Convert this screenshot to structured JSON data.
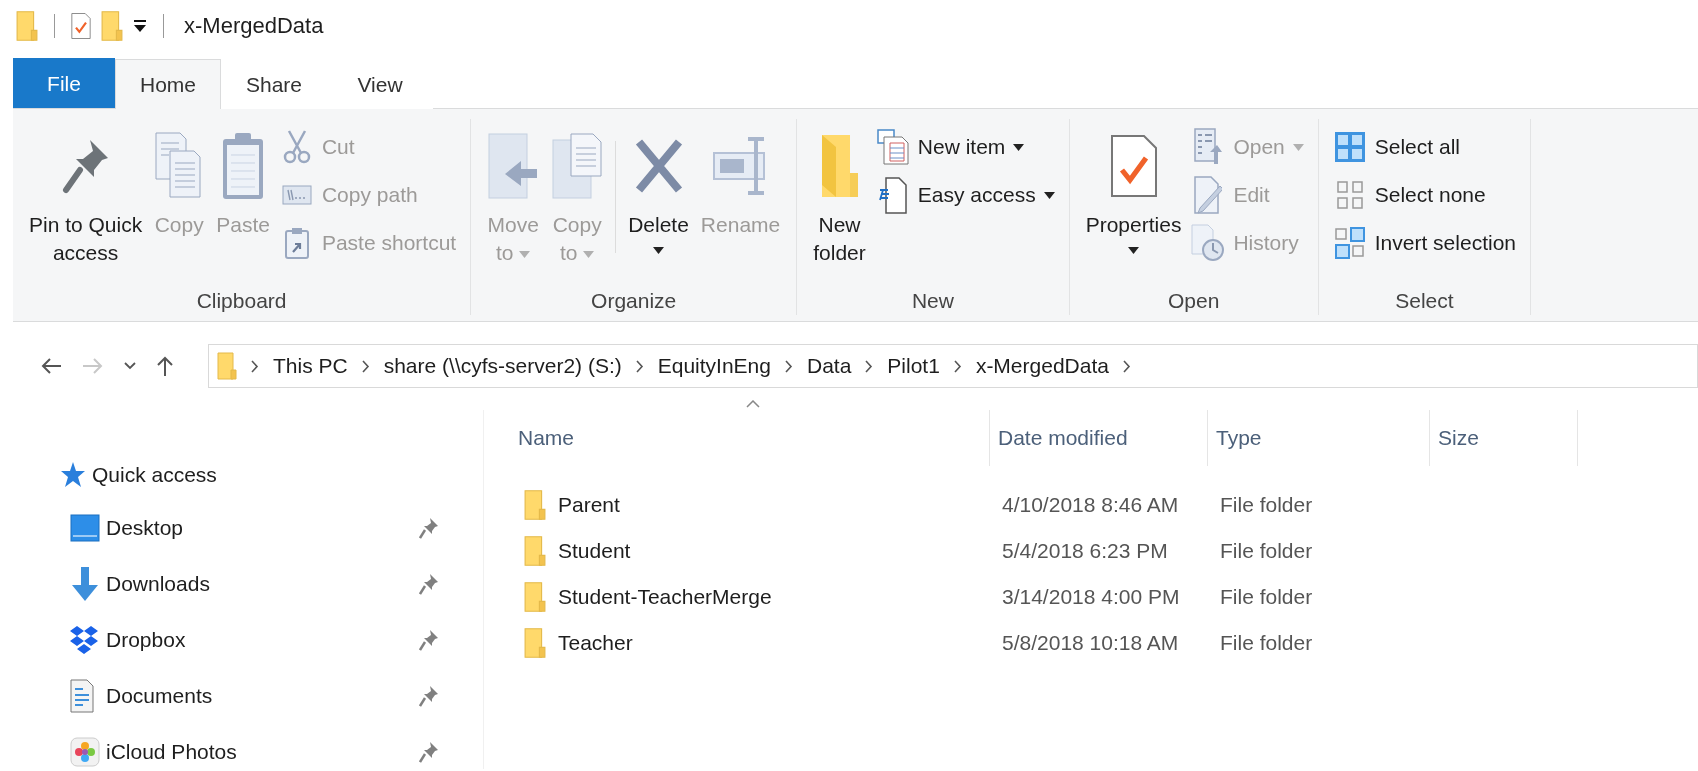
{
  "window": {
    "title": "x-MergedData"
  },
  "ribbon": {
    "tabs": [
      {
        "label": "File",
        "kind": "file",
        "selected": false
      },
      {
        "label": "Home",
        "kind": "tab",
        "selected": true
      },
      {
        "label": "Share",
        "kind": "tab",
        "selected": false
      },
      {
        "label": "View",
        "kind": "tab",
        "selected": false
      }
    ],
    "groups": [
      {
        "label": "Clipboard",
        "items": [
          {
            "kind": "large",
            "label": "Pin to Quick\naccess",
            "disabled": false,
            "dropdown": false
          },
          {
            "kind": "large",
            "label": "Copy",
            "disabled": true,
            "dropdown": false
          },
          {
            "kind": "large",
            "label": "Paste",
            "disabled": true,
            "dropdown": false
          },
          {
            "kind": "small",
            "label": "Cut",
            "disabled": true,
            "dropdown": false
          },
          {
            "kind": "small",
            "label": "Copy path",
            "disabled": true,
            "dropdown": false
          },
          {
            "kind": "small",
            "label": "Paste shortcut",
            "disabled": true,
            "dropdown": false
          }
        ]
      },
      {
        "label": "Organize",
        "items": [
          {
            "kind": "large",
            "label": "Move\nto",
            "disabled": true,
            "dropdown": true
          },
          {
            "kind": "large",
            "label": "Copy\nto",
            "disabled": true,
            "dropdown": true
          },
          {
            "kind": "divider"
          },
          {
            "kind": "large",
            "label": "Delete",
            "disabled": false,
            "dropdown": true
          },
          {
            "kind": "large",
            "label": "Rename",
            "disabled": true,
            "dropdown": false
          }
        ]
      },
      {
        "label": "New",
        "items": [
          {
            "kind": "large",
            "label": "New\nfolder",
            "disabled": false,
            "dropdown": false
          },
          {
            "kind": "small",
            "label": "New item",
            "disabled": false,
            "dropdown": true
          },
          {
            "kind": "small",
            "label": "Easy access",
            "disabled": false,
            "dropdown": true
          }
        ]
      },
      {
        "label": "Open",
        "items": [
          {
            "kind": "large",
            "label": "Properties",
            "disabled": false,
            "dropdown": true
          },
          {
            "kind": "small",
            "label": "Open",
            "disabled": true,
            "dropdown": true
          },
          {
            "kind": "small",
            "label": "Edit",
            "disabled": true,
            "dropdown": false
          },
          {
            "kind": "small",
            "label": "History",
            "disabled": true,
            "dropdown": false
          }
        ]
      },
      {
        "label": "Select",
        "items": [
          {
            "kind": "small",
            "label": "Select all",
            "disabled": false,
            "dropdown": false
          },
          {
            "kind": "small",
            "label": "Select none",
            "disabled": false,
            "dropdown": false
          },
          {
            "kind": "small",
            "label": "Invert selection",
            "disabled": false,
            "dropdown": false
          }
        ]
      }
    ]
  },
  "address_bar": {
    "nav_buttons": [
      {
        "kind": "back",
        "disabled": false
      },
      {
        "kind": "forward",
        "disabled": true
      },
      {
        "kind": "recent",
        "disabled": false
      },
      {
        "kind": "up",
        "disabled": false
      }
    ],
    "path": [
      "This PC",
      "share (\\\\cyfs-server2) (S:)",
      "EquityInEng",
      "Data",
      "Pilot1",
      "x-MergedData"
    ]
  },
  "navigation_pane": {
    "items": [
      {
        "kind": "header",
        "label": "Quick access"
      },
      {
        "kind": "pinned",
        "label": "Desktop"
      },
      {
        "kind": "pinned",
        "label": "Downloads"
      },
      {
        "kind": "pinned",
        "label": "Dropbox"
      },
      {
        "kind": "pinned",
        "label": "Documents"
      },
      {
        "kind": "pinned",
        "label": "iCloud Photos"
      }
    ]
  },
  "file_list": {
    "columns": [
      {
        "label": "Name",
        "sorted": true
      },
      {
        "label": "Date modified",
        "sorted": false
      },
      {
        "label": "Type",
        "sorted": false
      },
      {
        "label": "Size",
        "sorted": false
      }
    ],
    "rows": [
      {
        "name": "Parent",
        "date_modified": "4/10/2018 8:46 AM",
        "type": "File folder",
        "selected": false
      },
      {
        "name": "Student",
        "date_modified": "5/4/2018 6:23 PM",
        "type": "File folder",
        "selected": false
      },
      {
        "name": "Student-TeacherMerge",
        "date_modified": "3/14/2018 4:00 PM",
        "type": "File folder",
        "selected": false
      },
      {
        "name": "Teacher",
        "date_modified": "5/8/2018 10:18 AM",
        "type": "File folder",
        "selected": false
      }
    ]
  }
}
